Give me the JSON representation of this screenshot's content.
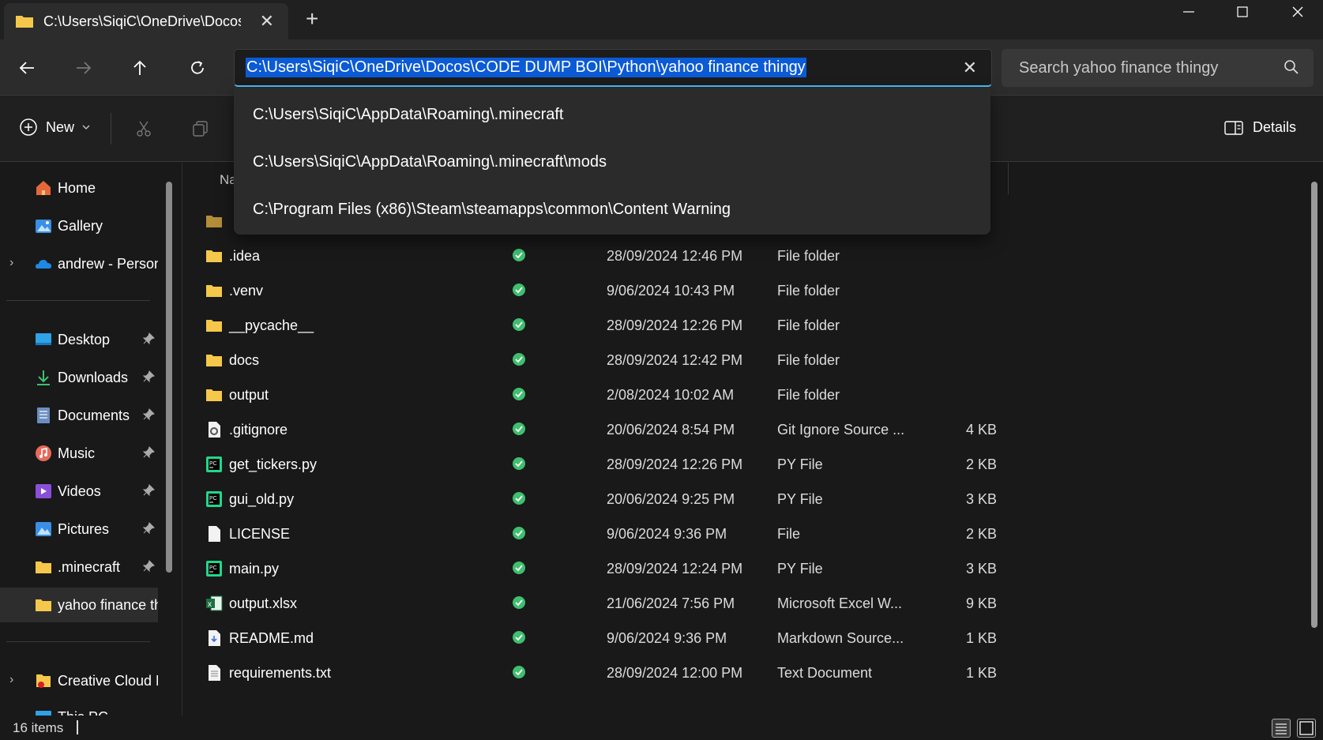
{
  "tab": {
    "title": "C:\\Users\\SiqiC\\OneDrive\\Docos\\CODE DUMP BOI\\Python\\yahoo finance thingy",
    "close": "✕",
    "new_tab": "+"
  },
  "window": {
    "minimize": "—",
    "maximize": "☐",
    "close": "✕"
  },
  "address": {
    "value": "C:\\Users\\SiqiC\\OneDrive\\Docos\\CODE DUMP BOI\\Python\\yahoo finance thingy",
    "clear": "✕"
  },
  "search": {
    "placeholder": "Search yahoo finance thingy"
  },
  "suggestions": [
    "C:\\Users\\SiqiC\\AppData\\Roaming\\.minecraft",
    "C:\\Users\\SiqiC\\AppData\\Roaming\\.minecraft\\mods",
    "C:\\Program Files (x86)\\Steam\\steamapps\\common\\Content Warning"
  ],
  "commandbar": {
    "new_label": "New",
    "details_label": "Details"
  },
  "columns": {
    "name_partial": "Na"
  },
  "sidebar": {
    "home": "Home",
    "gallery": "Gallery",
    "onedrive": "andrew - Personal",
    "pinned": [
      {
        "label": "Desktop",
        "icon": "desktop-icon"
      },
      {
        "label": "Downloads",
        "icon": "downloads-icon"
      },
      {
        "label": "Documents",
        "icon": "documents-icon"
      },
      {
        "label": "Music",
        "icon": "music-icon"
      },
      {
        "label": "Videos",
        "icon": "videos-icon"
      },
      {
        "label": "Pictures",
        "icon": "pictures-icon"
      },
      {
        "label": ".minecraft",
        "icon": "folder-icon"
      }
    ],
    "current": "yahoo finance thingy",
    "creative_cloud": "Creative Cloud Files",
    "this_pc": "This PC"
  },
  "files": [
    {
      "name": ".idea",
      "date": "28/09/2024 12:46 PM",
      "type": "File folder",
      "size": "",
      "icon": "folder"
    },
    {
      "name": ".venv",
      "date": "9/06/2024 10:43 PM",
      "type": "File folder",
      "size": "",
      "icon": "folder"
    },
    {
      "name": "__pycache__",
      "date": "28/09/2024 12:26 PM",
      "type": "File folder",
      "size": "",
      "icon": "folder"
    },
    {
      "name": "docs",
      "date": "28/09/2024 12:42 PM",
      "type": "File folder",
      "size": "",
      "icon": "folder"
    },
    {
      "name": "output",
      "date": "2/08/2024 10:02 AM",
      "type": "File folder",
      "size": "",
      "icon": "folder"
    },
    {
      "name": ".gitignore",
      "date": "20/06/2024 8:54 PM",
      "type": "Git Ignore Source ...",
      "size": "4 KB",
      "icon": "gear"
    },
    {
      "name": "get_tickers.py",
      "date": "28/09/2024 12:26 PM",
      "type": "PY File",
      "size": "2 KB",
      "icon": "py"
    },
    {
      "name": "gui_old.py",
      "date": "20/06/2024 9:25 PM",
      "type": "PY File",
      "size": "3 KB",
      "icon": "py"
    },
    {
      "name": "LICENSE",
      "date": "9/06/2024 9:36 PM",
      "type": "File",
      "size": "2 KB",
      "icon": "doc"
    },
    {
      "name": "main.py",
      "date": "28/09/2024 12:24 PM",
      "type": "PY File",
      "size": "3 KB",
      "icon": "py"
    },
    {
      "name": "output.xlsx",
      "date": "21/06/2024 7:56 PM",
      "type": "Microsoft Excel W...",
      "size": "9 KB",
      "icon": "excel"
    },
    {
      "name": "README.md",
      "date": "9/06/2024 9:36 PM",
      "type": "Markdown Source...",
      "size": "1 KB",
      "icon": "md"
    },
    {
      "name": "requirements.txt",
      "date": "28/09/2024 12:00 PM",
      "type": "Text Document",
      "size": "1 KB",
      "icon": "txt"
    }
  ],
  "status": {
    "count": "16 items"
  },
  "colors": {
    "accent": "#4cc2ff",
    "selection": "#0b5ad6",
    "folder": "#f5c84b",
    "synced": "#3fbf6f"
  }
}
